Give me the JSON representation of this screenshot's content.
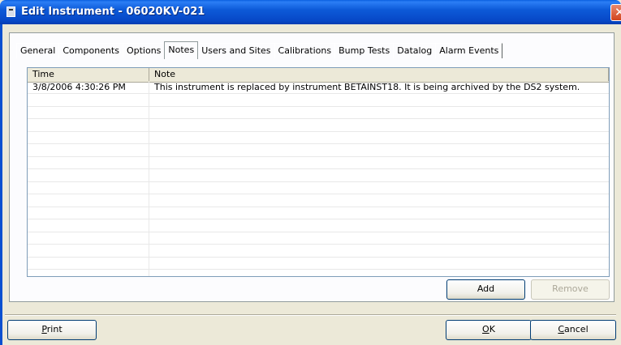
{
  "window": {
    "title": "Edit Instrument - 06020KV-021",
    "close_glyph": "✕"
  },
  "tabs": [
    {
      "label": "General",
      "active": false
    },
    {
      "label": "Components",
      "active": false
    },
    {
      "label": "Options",
      "active": false
    },
    {
      "label": "Notes",
      "active": true
    },
    {
      "label": "Users and Sites",
      "active": false
    },
    {
      "label": "Calibrations",
      "active": false
    },
    {
      "label": "Bump Tests",
      "active": false
    },
    {
      "label": "Datalog",
      "active": false
    },
    {
      "label": "Alarm Events",
      "active": false
    }
  ],
  "notes_table": {
    "columns": [
      "Time",
      "Note"
    ],
    "rows": [
      [
        "3/8/2006 4:30:26 PM",
        "This instrument is replaced by instrument BETAINST18.  It is being archived by the DS2 system."
      ]
    ]
  },
  "buttons": {
    "add": "Add",
    "remove": "Remove",
    "print": "Print",
    "ok": "OK",
    "cancel": "Cancel"
  },
  "colors": {
    "titlebar": "#0d5ad8",
    "dialog_bg": "#ece9d8",
    "close_button": "#d2441d"
  }
}
